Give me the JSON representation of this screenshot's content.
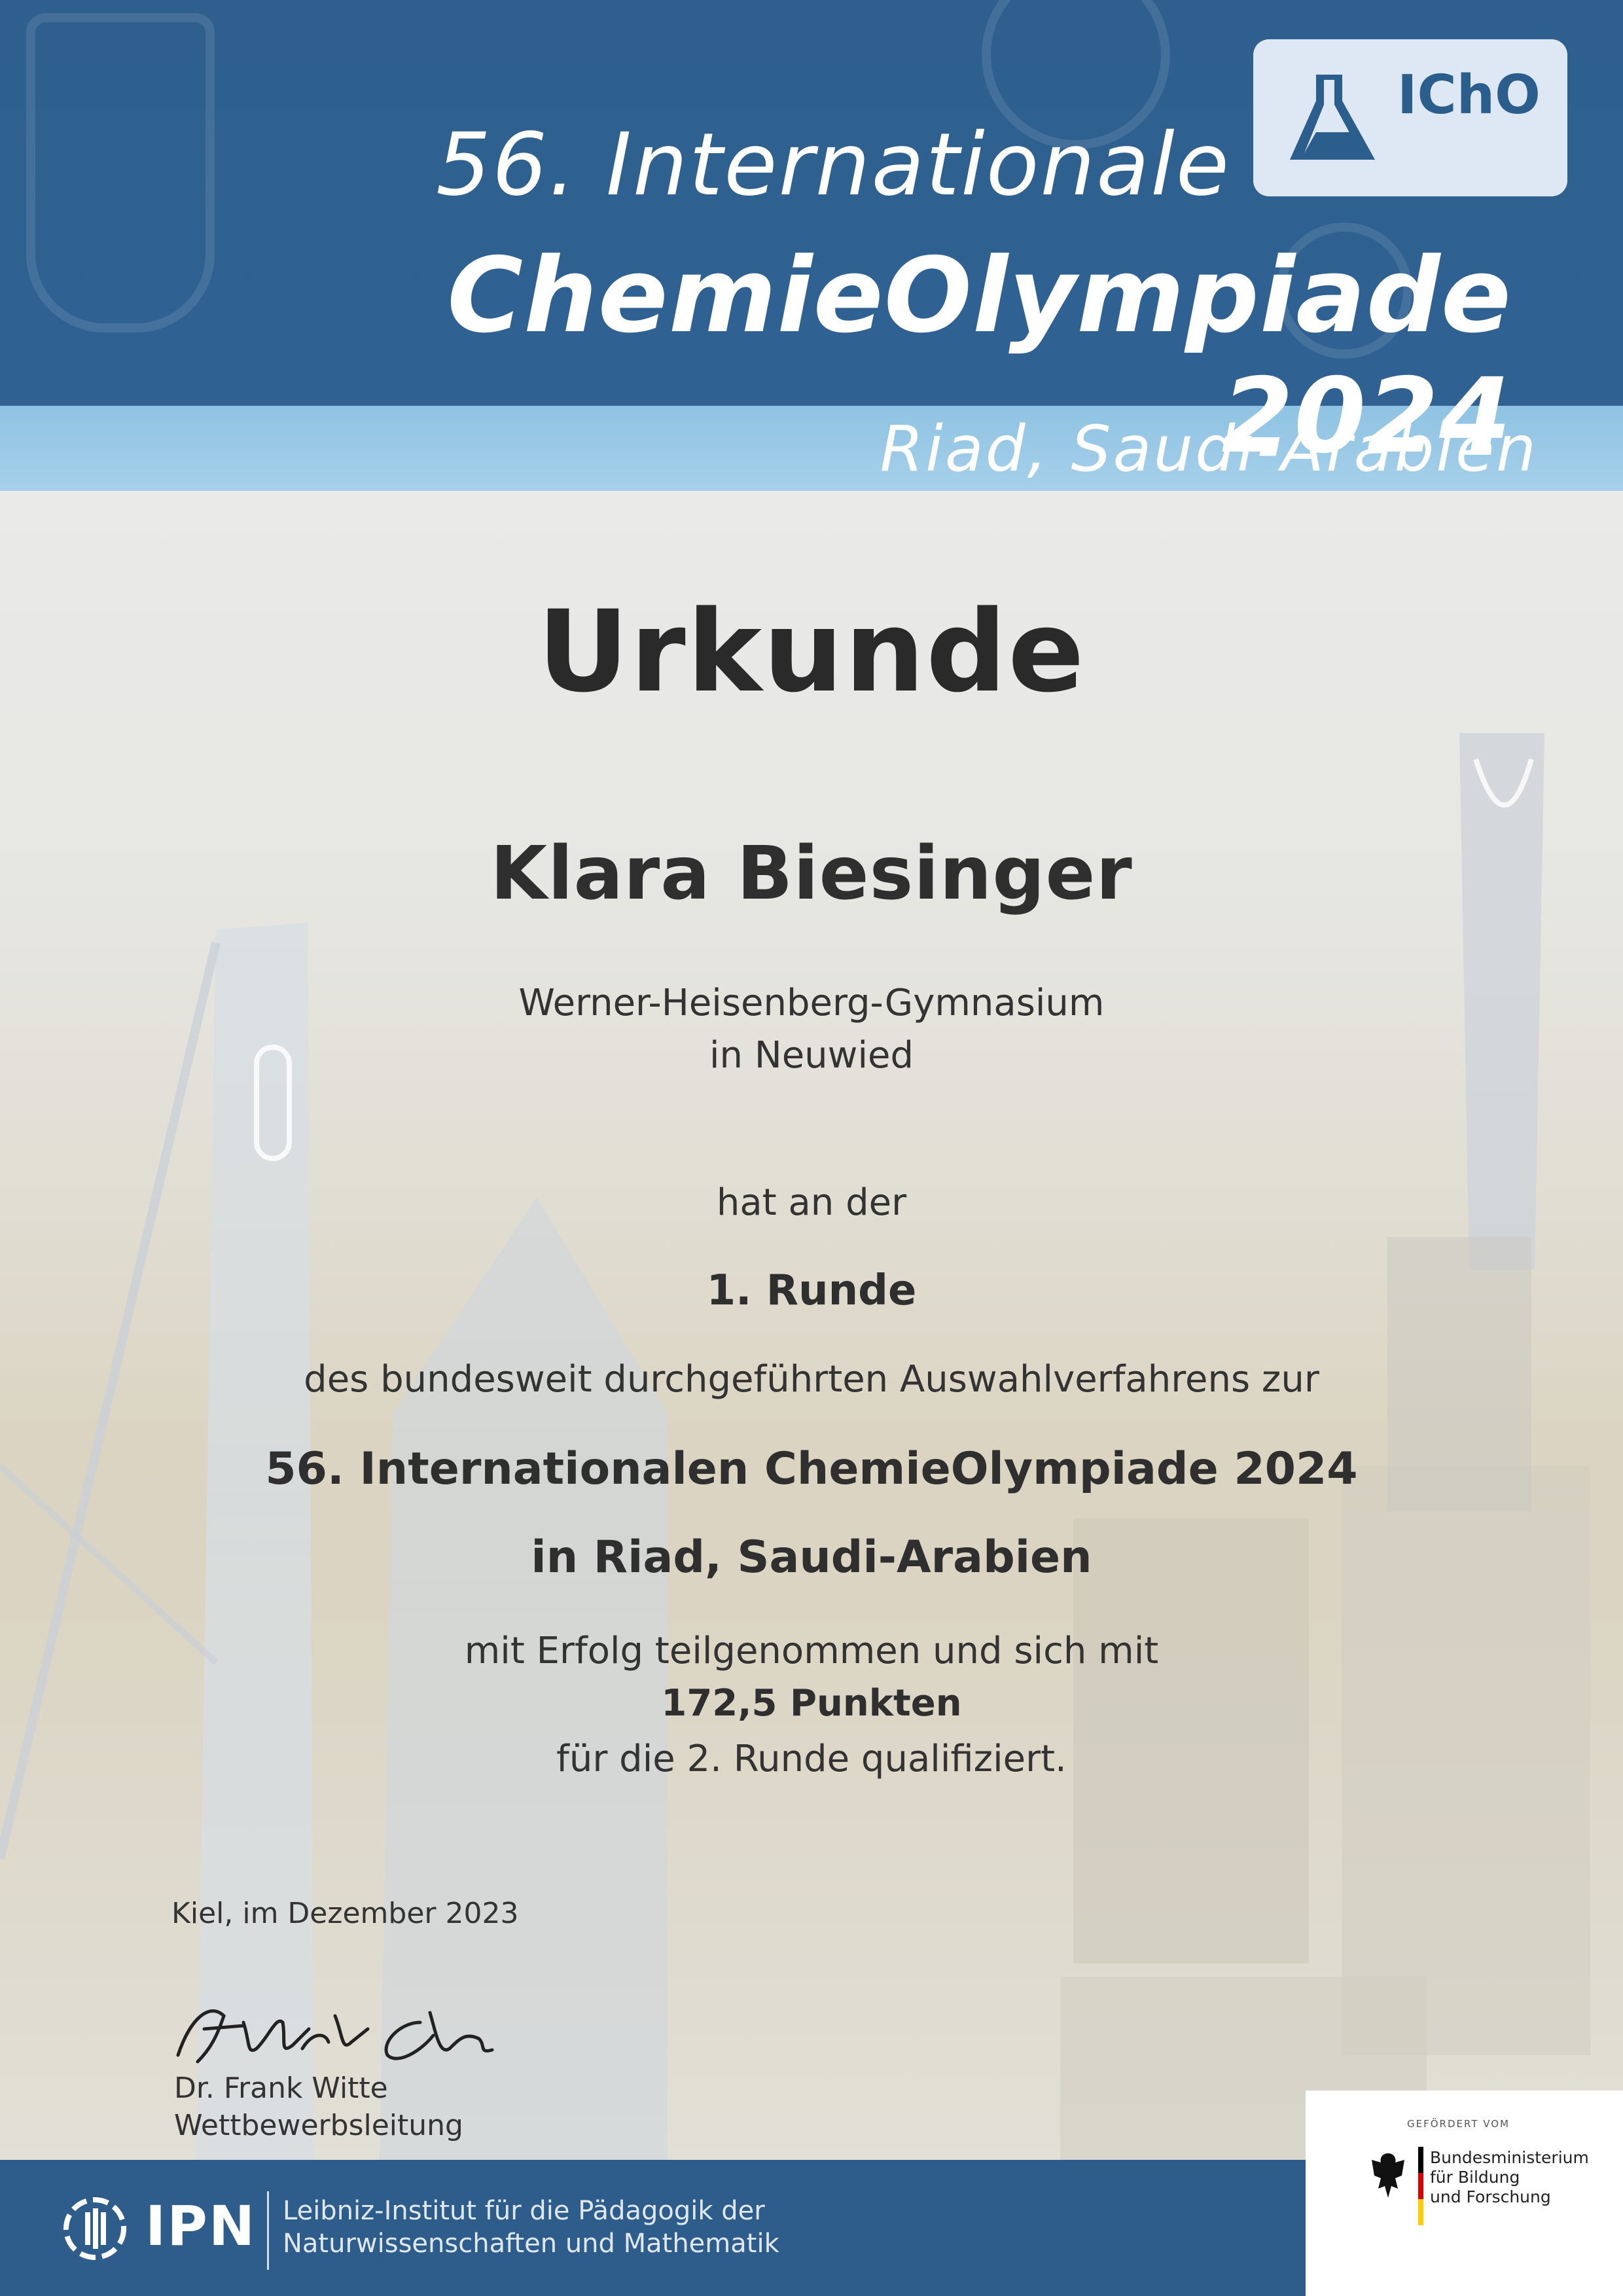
{
  "header": {
    "line1": "56. Internationale",
    "line2": "ChemieOlympiade 2024",
    "location": "Riad, Saudi-Arabien",
    "logo_text": "IChO"
  },
  "certificate": {
    "title": "Urkunde",
    "recipient_name": "Klara Biesinger",
    "school_name": "Werner-Heisenberg-Gymnasium",
    "school_city": "in Neuwied",
    "participation_line": "hat an der",
    "round_name": "1. Runde",
    "selection_line": "des bundesweit durchgeführten Auswahlverfahrens zur",
    "competition_line": "56. Internationalen ChemieOlympiade 2024",
    "competition_location": "in Riad, Saudi-Arabien",
    "result_line1": "mit Erfolg teilgenommen und sich mit",
    "result_points": "172,5 Punkten",
    "result_line2": "für die 2. Runde qualifiziert."
  },
  "signature_block": {
    "place_date": "Kiel, im Dezember 2023",
    "signer_name": "Dr. Frank Witte",
    "signer_role": "Wettbewerbsleitung"
  },
  "footer": {
    "ipn_label": "IPN",
    "ipn_name_line1": "Leibniz-Institut für die Pädagogik der",
    "ipn_name_line2": "Naturwissenschaften und Mathematik",
    "funded_by": "GEFÖRDERT VOM",
    "ministry_line1": "Bundesministerium",
    "ministry_line2": "für Bildung",
    "ministry_line3": "und Forschung"
  },
  "colors": {
    "header_blue": "#2e5f8e",
    "light_blue": "#a6d0ea",
    "footer_blue": "#2e5d8c",
    "text_dark": "#2b2b2b"
  }
}
